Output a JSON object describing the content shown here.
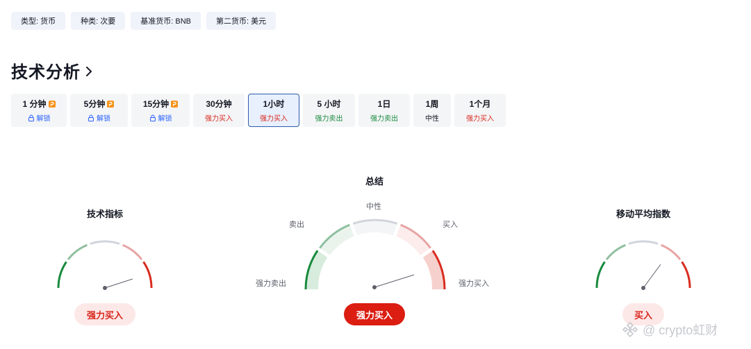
{
  "tags": [
    {
      "label": "类型: 货币"
    },
    {
      "label": "种类: 次要"
    },
    {
      "label": "基准货币: BNB"
    },
    {
      "label": "第二货币: 美元"
    }
  ],
  "section": {
    "title": "技术分析"
  },
  "timeframes": [
    {
      "label": "1 分钟",
      "sub": "解锁",
      "locked": true
    },
    {
      "label": "5分钟",
      "sub": "解锁",
      "locked": true
    },
    {
      "label": "15分钟",
      "sub": "解锁",
      "locked": true
    },
    {
      "label": "30分钟",
      "sub": "强力买入",
      "signal": "buy"
    },
    {
      "label": "1小时",
      "sub": "强力买入",
      "signal": "buy",
      "active": true
    },
    {
      "label": "5 小时",
      "sub": "强力卖出",
      "signal": "sell"
    },
    {
      "label": "1日",
      "sub": "强力卖出",
      "signal": "sell"
    },
    {
      "label": "1周",
      "sub": "中性",
      "signal": "neutral"
    },
    {
      "label": "1个月",
      "sub": "强力买入",
      "signal": "buy"
    }
  ],
  "gauges": {
    "indicators": {
      "title": "技术指标",
      "result": "强力买入"
    },
    "summary": {
      "title": "总结",
      "result": "强力买入",
      "labels": {
        "strong_sell": "强力卖出",
        "sell": "卖出",
        "neutral": "中性",
        "buy": "买入",
        "strong_buy": "强力买入"
      }
    },
    "moving_averages": {
      "title": "移动平均指数",
      "result": "买入"
    }
  },
  "colors": {
    "buy": "#d92b1e",
    "sell": "#188a3d",
    "active_border": "#2a5ca8",
    "pill_solid": "#db1d12",
    "pill_light": "#fde8e8"
  },
  "watermark": {
    "text": "@ crypto虹财"
  }
}
